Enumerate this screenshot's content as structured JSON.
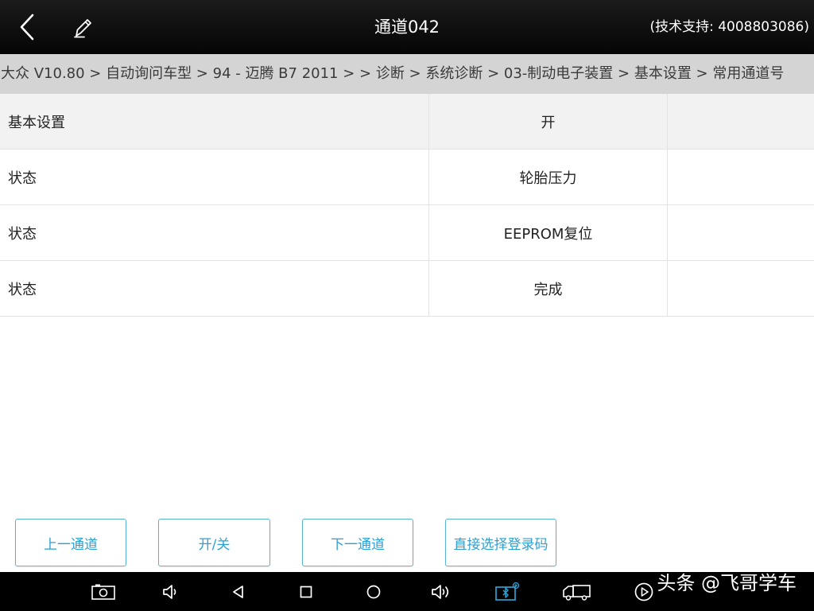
{
  "header": {
    "title": "通道042",
    "support": "(技术支持: 4008803086)"
  },
  "breadcrumb": "大众 V10.80 > 自动询问车型 > 94 - 迈腾 B7 2011 > > 诊断 > 系统诊断 > 03-制动电子装置 > 基本设置 > 常用通道号",
  "table": {
    "header": {
      "name": "基本设置",
      "value": "开"
    },
    "rows": [
      {
        "name": "状态",
        "value": "轮胎压力"
      },
      {
        "name": "状态",
        "value": "EEPROM复位"
      },
      {
        "name": "状态",
        "value": "完成"
      }
    ]
  },
  "buttons": {
    "prev": "上一通道",
    "toggle": "开/关",
    "next": "下一通道",
    "login": "直接选择登录码"
  },
  "watermark": "头条 @飞哥学车",
  "colors": {
    "accent": "#2da0d2",
    "topbar": "#0a0a0a",
    "breadcrumb_bg": "#d4d4d4"
  }
}
